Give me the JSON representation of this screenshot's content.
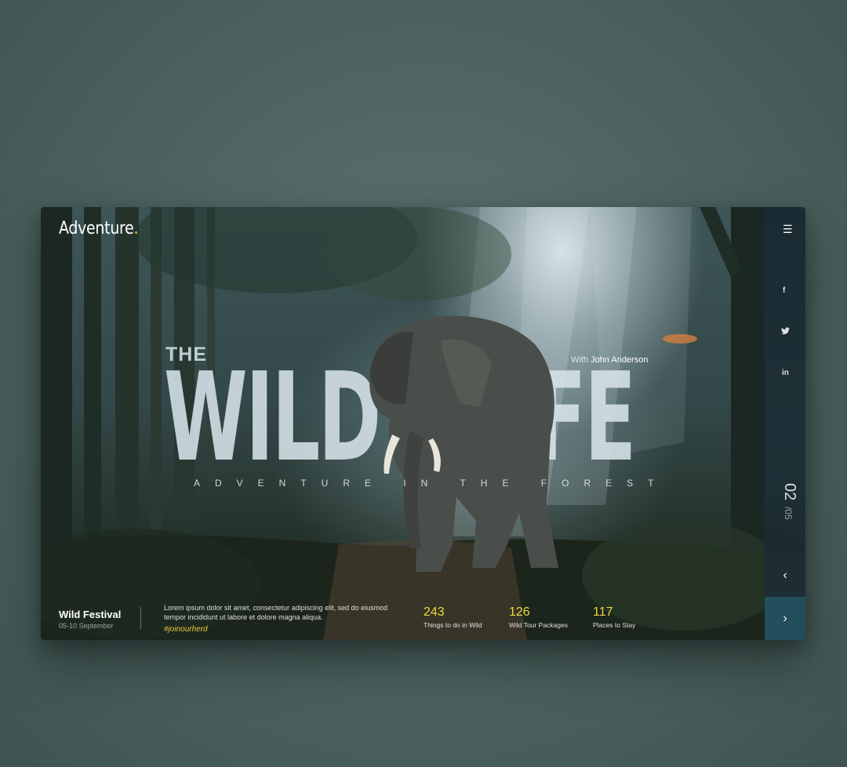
{
  "brand": {
    "name": "Adventure",
    "dot": "."
  },
  "hero": {
    "the": "THE",
    "title_part1": "WILD",
    "title_part2": "LIFE",
    "byline_prefix": "With",
    "byline_name": "John Anderson",
    "subtitle": "ADVENTURE IN THE FOREST"
  },
  "event": {
    "title": "Wild Festival",
    "date": "05-10 September"
  },
  "description": {
    "text": "Lorem ipsum dolor sit amet, consectetur adipiscing elit, sed do eiusmod tempor incididunt ut labore et dolore magna aliqua.",
    "hashtag": "#joinourherd"
  },
  "stats": [
    {
      "value": "243",
      "label": "Things to do in Wild"
    },
    {
      "value": "126",
      "label": "Wild Tour Packages"
    },
    {
      "value": "117",
      "label": "Places to Stay"
    }
  ],
  "sidebar": {
    "menu_icon": "☰",
    "social": [
      {
        "icon": "facebook-icon",
        "glyph": "f"
      },
      {
        "icon": "twitter-icon",
        "glyph": "🐦"
      },
      {
        "icon": "linkedin-icon",
        "glyph": "in"
      }
    ],
    "page_current": "02",
    "page_total": "/05",
    "prev_glyph": "‹",
    "next_glyph": "›"
  },
  "colors": {
    "accent": "#f0d93c",
    "next_button": "#234e5b",
    "sidebar": "#1b2b33"
  }
}
